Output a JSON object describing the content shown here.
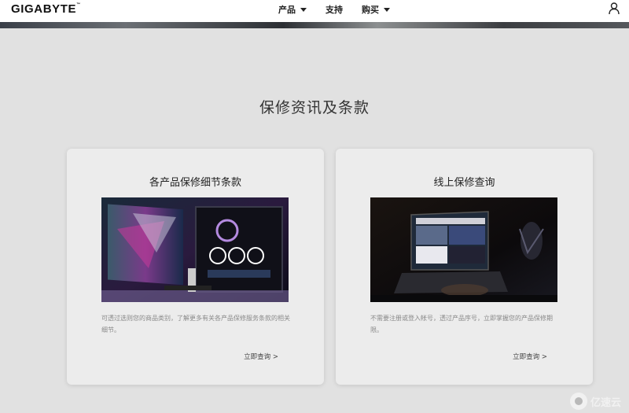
{
  "header": {
    "logo": "GIGABYTE",
    "logo_mark": "™",
    "nav": [
      {
        "label": "产品"
      },
      {
        "label": "支持"
      },
      {
        "label": "购买"
      }
    ]
  },
  "main": {
    "title": "保修资讯及条款",
    "cards": [
      {
        "title": "各产品保修细节条款",
        "desc": "可透过选则您的商品类别，了解更多有关各产品保修服务条款的相关细节。",
        "link": "立即查询 >"
      },
      {
        "title": "线上保修查询",
        "desc": "不需要注册或登入帐号，透过产品序号，立即掌握您的产品保修期限。",
        "link": "立即查询 >"
      }
    ]
  },
  "watermark": {
    "text": "亿速云"
  },
  "colors": {
    "page_bg": "#e1e1e1",
    "card_bg": "#ececec",
    "header_bg": "#ffffff"
  },
  "icons": [
    "caret-down-icon",
    "user-icon"
  ]
}
